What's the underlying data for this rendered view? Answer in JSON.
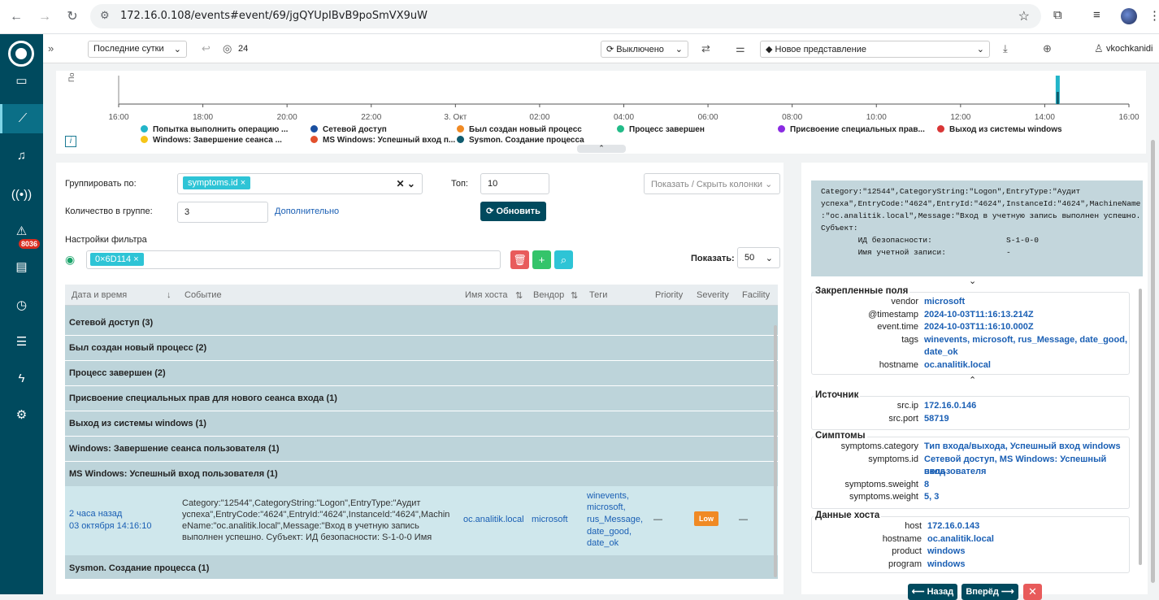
{
  "browser": {
    "url": "172.16.0.108/events#event/69/jgQYUpIBvB9poSmVX9uW"
  },
  "topbar": {
    "period": "Последние сутки",
    "count": "24",
    "autorefresh": "Выключено",
    "view": "Новое представление",
    "user": "vkochkanidi"
  },
  "sidebar": {
    "badge": "8036"
  },
  "chart_data": {
    "type": "bar",
    "ylabel": "По",
    "x_ticks": [
      "16:00",
      "18:00",
      "20:00",
      "22:00",
      "3. Окт",
      "02:00",
      "04:00",
      "06:00",
      "08:00",
      "10:00",
      "12:00",
      "14:00",
      "16:00"
    ],
    "series": [
      {
        "name": "Попытка выполнить операцию ...",
        "color": "#22b5c9"
      },
      {
        "name": "Сетевой доступ",
        "color": "#1a4fa0"
      },
      {
        "name": "Был создан новый процесс",
        "color": "#f08a24"
      },
      {
        "name": "Процесс завершен",
        "color": "#22bb88"
      },
      {
        "name": "Присвоение специальных прав...",
        "color": "#8a2be2"
      },
      {
        "name": "Выход из системы windows",
        "color": "#d93636"
      },
      {
        "name": "Windows: Завершение сеанса ...",
        "color": "#f5c518"
      },
      {
        "name": "MS Windows: Успешный вход п...",
        "color": "#e2502c"
      },
      {
        "name": "Sysmon. Создание процесса",
        "color": "#0f5b6e"
      }
    ]
  },
  "filters": {
    "group_by_label": "Группировать по:",
    "group_by_value": "symptoms.id",
    "top_label": "Топ:",
    "top_value": "10",
    "count_label": "Количество в группе:",
    "count_value": "3",
    "advanced": "Дополнительно",
    "refresh": "Обновить",
    "columns_btn": "Показать / Скрыть колонки",
    "filter_settings": "Настройки фильтра",
    "filter_chip": "0×6D114",
    "show_label": "Показать:",
    "show_value": "50"
  },
  "grid": {
    "headers": [
      "Дата и время",
      "Событие",
      "Имя хоста",
      "Вендор",
      "Теги",
      "Priority",
      "Severity",
      "Facility"
    ],
    "groups": [
      "Сетевой доступ (3)",
      "Был создан новый процесс (2)",
      "Процесс завершен (2)",
      "Присвоение специальных прав для нового сеанса входа (1)",
      "Выход из системы windows (1)",
      "Windows: Завершение сеанса пользователя (1)",
      "MS Windows: Успешный вход пользователя (1)"
    ],
    "last_group": "Sysmon. Создание процесса (1)",
    "row": {
      "time_rel": "2 часа назад",
      "time_abs": "03 октября 14:16:10",
      "event_l1": "Category:\"12544\",CategoryString:\"Logon\",EntryType:\"Аудит",
      "event_l2": "успеха\",EntryCode:\"4624\",EntryId:\"4624\",InstanceId:\"4624\",Machin",
      "event_l3": "eName:\"oc.analitik.local\",Message:\"Вход в учетную запись",
      "event_l4": "выполнен успешно. Субъект: ИД безопасности: S-1-0-0 Имя",
      "host": "oc.analitik.local",
      "vendor": "microsoft",
      "tags": [
        "winevents,",
        "microsoft,",
        "rus_Message,",
        "date_good,",
        "date_ok"
      ],
      "priority": "—",
      "severity": "Low",
      "facility": "—"
    }
  },
  "detail": {
    "raw_lines": [
      "Category:\"12544\",CategoryString:\"Logon\",EntryType:\"Аудит",
      "успеха\",EntryCode:\"4624\",EntryId:\"4624\",InstanceId:\"4624\",MachineName",
      ":\"oc.analitik.local\",Message:\"Вход в учетную запись выполнен успешно.",
      "",
      "Субъект:",
      "\tИД безопасности:\t\tS-1-0-0",
      "\tИмя учетной записи:\t\t-"
    ],
    "pinned": {
      "title": "Закрепленные поля",
      "rows": [
        [
          "vendor",
          "microsoft"
        ],
        [
          "@timestamp",
          "2024-10-03T11:16:13.214Z"
        ],
        [
          "event.time",
          "2024-10-03T11:16:10.000Z"
        ],
        [
          "tags",
          "winevents, microsoft, rus_Message, date_good,"
        ],
        [
          "",
          "date_ok"
        ],
        [
          "hostname",
          "oc.analitik.local"
        ]
      ]
    },
    "source": {
      "title": "Источник",
      "rows": [
        [
          "src.ip",
          "172.16.0.146"
        ],
        [
          "src.port",
          "58719"
        ]
      ]
    },
    "symptoms": {
      "title": "Симптомы",
      "rows": [
        [
          "symptoms.category",
          "Тип входа/выхода, Успешный вход windows"
        ],
        [
          "symptoms.id",
          "Сетевой доступ, MS Windows: Успешный вход"
        ],
        [
          "",
          "пользователя"
        ],
        [
          "symptoms.sweight",
          "8"
        ],
        [
          "symptoms.weight",
          "5, 3"
        ]
      ]
    },
    "host": {
      "title": "Данные хоста",
      "rows": [
        [
          "host",
          "172.16.0.143"
        ],
        [
          "hostname",
          "oc.analitik.local"
        ],
        [
          "product",
          "windows"
        ],
        [
          "program",
          "windows"
        ]
      ]
    },
    "back": "Назад",
    "forward": "Вперёд"
  }
}
